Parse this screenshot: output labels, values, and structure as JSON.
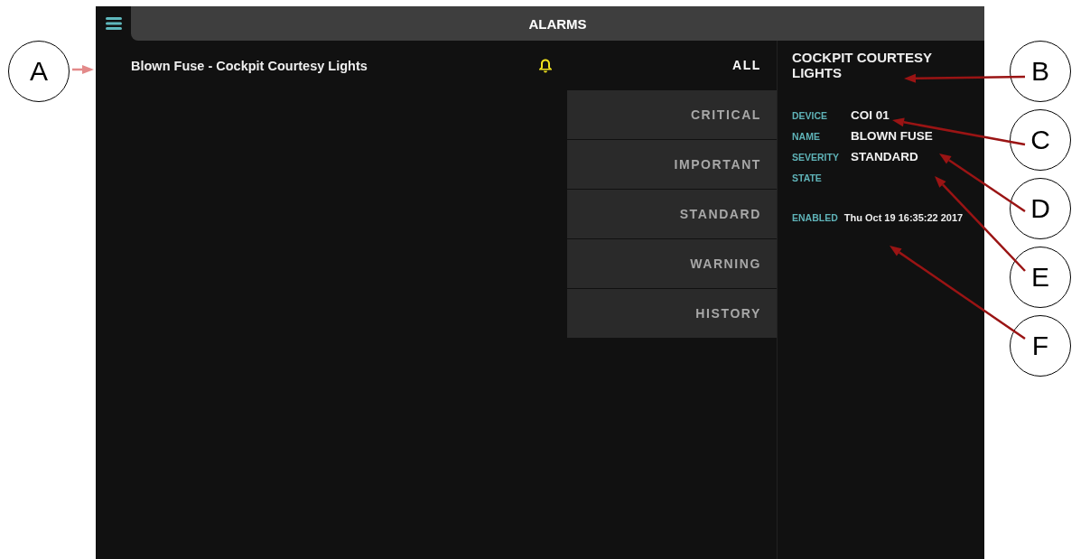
{
  "header": {
    "title": "ALARMS"
  },
  "alarms": [
    {
      "title": "Blown Fuse - Cockpit Courtesy Lights",
      "active": true
    }
  ],
  "filters": [
    {
      "label": "ALL",
      "selected": true
    },
    {
      "label": "CRITICAL",
      "selected": false
    },
    {
      "label": "IMPORTANT",
      "selected": false
    },
    {
      "label": "STANDARD",
      "selected": false
    },
    {
      "label": "WARNING",
      "selected": false
    },
    {
      "label": "HISTORY",
      "selected": false
    }
  ],
  "detail": {
    "title": "COCKPIT COURTESY LIGHTS",
    "fields": [
      {
        "label": "DEVICE",
        "value": "COI 01"
      },
      {
        "label": "NAME",
        "value": "BLOWN FUSE"
      },
      {
        "label": "SEVERITY",
        "value": "STANDARD"
      },
      {
        "label": "STATE"
      }
    ],
    "enabled": {
      "label": "ENABLED",
      "value": "Thu Oct 19 16:35:22 2017"
    }
  },
  "callouts": {
    "left": [
      {
        "label": "A"
      }
    ],
    "right": [
      {
        "label": "B"
      },
      {
        "label": "C"
      },
      {
        "label": "D"
      },
      {
        "label": "E"
      },
      {
        "label": "F"
      }
    ]
  }
}
